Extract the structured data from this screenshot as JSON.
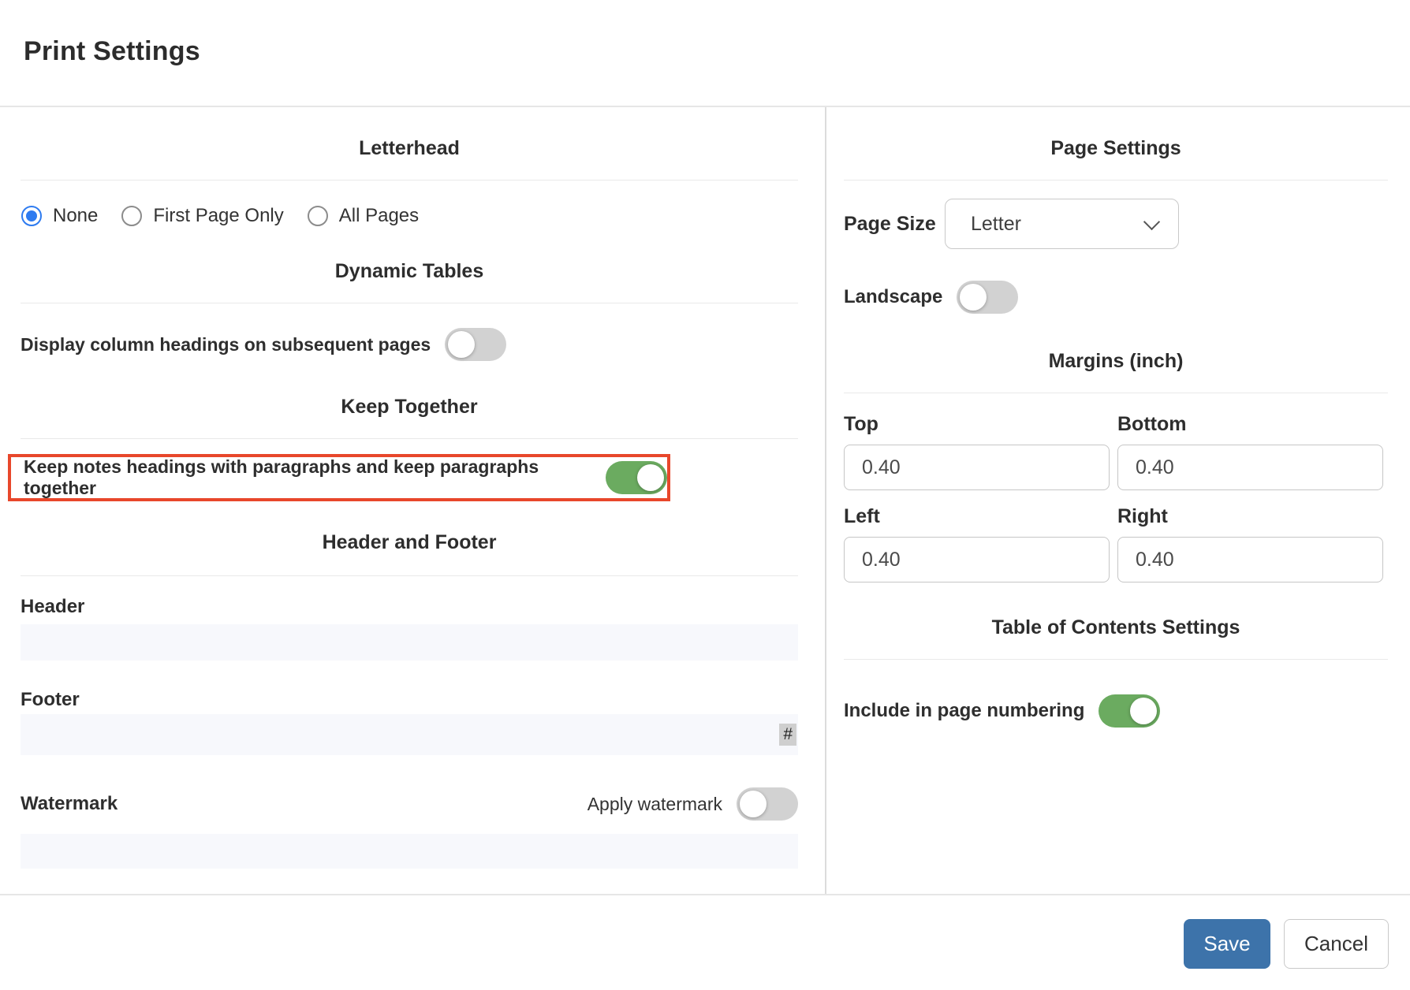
{
  "page": {
    "title": "Print Settings"
  },
  "letterhead": {
    "heading": "Letterhead",
    "options": [
      {
        "label": "None",
        "selected": true
      },
      {
        "label": "First Page Only",
        "selected": false
      },
      {
        "label": "All Pages",
        "selected": false
      }
    ]
  },
  "dynamic_tables": {
    "heading": "Dynamic Tables",
    "display_column_headings": {
      "label": "Display column headings on subsequent pages",
      "enabled": false
    }
  },
  "keep_together": {
    "heading": "Keep Together",
    "keep_notes": {
      "label": "Keep notes headings with paragraphs and keep paragraphs together",
      "enabled": true,
      "highlighted": true
    }
  },
  "header_footer": {
    "heading": "Header and Footer",
    "header": {
      "label": "Header",
      "value": ""
    },
    "footer": {
      "label": "Footer",
      "value": "",
      "page_number_token": "#"
    }
  },
  "watermark": {
    "label": "Watermark",
    "apply_label": "Apply watermark",
    "enabled": false,
    "value": ""
  },
  "page_settings": {
    "heading": "Page Settings",
    "page_size": {
      "label": "Page Size",
      "value": "Letter"
    },
    "landscape": {
      "label": "Landscape",
      "enabled": false
    }
  },
  "margins": {
    "heading": "Margins (inch)",
    "fields": [
      {
        "label": "Top",
        "value": "0.40"
      },
      {
        "label": "Bottom",
        "value": "0.40"
      },
      {
        "label": "Left",
        "value": "0.40"
      },
      {
        "label": "Right",
        "value": "0.40"
      }
    ]
  },
  "toc_settings": {
    "heading": "Table of Contents Settings",
    "include_page_numbering": {
      "label": "Include in page numbering",
      "enabled": true
    }
  },
  "footer_bar": {
    "save_label": "Save",
    "cancel_label": "Cancel"
  },
  "colors": {
    "toggle_on_green": "#6bab60",
    "toggle_off_gray": "#d2d2d2",
    "highlight_red": "#e8472b",
    "radio_blue": "#2e7bf0",
    "save_blue": "#3d73aa",
    "soft_input_bg": "#f7f8fc"
  }
}
